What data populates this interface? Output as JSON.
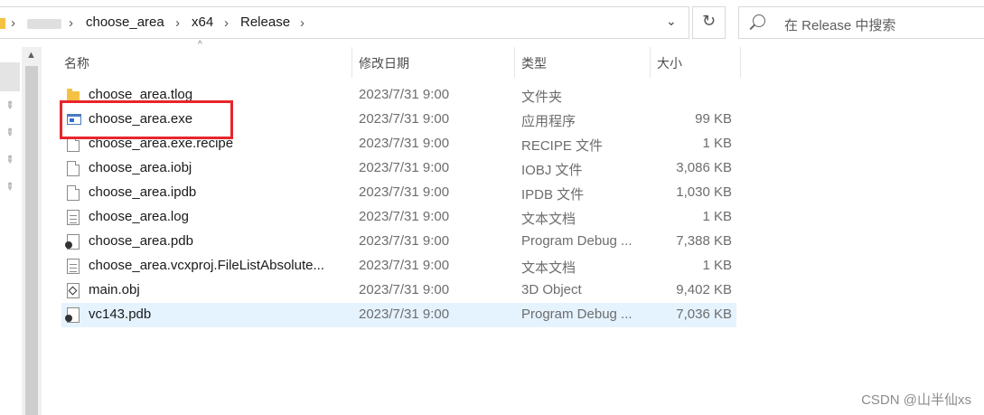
{
  "address": {
    "crumbs": [
      "choose_area",
      "x64",
      "Release"
    ],
    "separator": "›",
    "dropdown": "⌄",
    "refresh": "↻"
  },
  "search": {
    "placeholder": "在 Release 中搜索"
  },
  "columns": {
    "name": "名称",
    "modified": "修改日期",
    "type": "类型",
    "size": "大小"
  },
  "files": [
    {
      "name": "choose_area.tlog",
      "modified": "2023/7/31 9:00",
      "type": "文件夹",
      "size": "",
      "icon": "folder-icon"
    },
    {
      "name": "choose_area.exe",
      "modified": "2023/7/31 9:00",
      "type": "应用程序",
      "size": "99 KB",
      "icon": "exe-icon"
    },
    {
      "name": "choose_area.exe.recipe",
      "modified": "2023/7/31 9:00",
      "type": "RECIPE 文件",
      "size": "1 KB",
      "icon": "file-icon"
    },
    {
      "name": "choose_area.iobj",
      "modified": "2023/7/31 9:00",
      "type": "IOBJ 文件",
      "size": "3,086 KB",
      "icon": "file-icon"
    },
    {
      "name": "choose_area.ipdb",
      "modified": "2023/7/31 9:00",
      "type": "IPDB 文件",
      "size": "1,030 KB",
      "icon": "file-icon"
    },
    {
      "name": "choose_area.log",
      "modified": "2023/7/31 9:00",
      "type": "文本文档",
      "size": "1 KB",
      "icon": "text-file-icon"
    },
    {
      "name": "choose_area.pdb",
      "modified": "2023/7/31 9:00",
      "type": "Program Debug ...",
      "size": "7,388 KB",
      "icon": "pdb-icon"
    },
    {
      "name": "choose_area.vcxproj.FileListAbsolute...",
      "modified": "2023/7/31 9:00",
      "type": "文本文档",
      "size": "1 KB",
      "icon": "text-file-icon"
    },
    {
      "name": "main.obj",
      "modified": "2023/7/31 9:00",
      "type": "3D Object",
      "size": "9,402 KB",
      "icon": "3d-object-icon"
    },
    {
      "name": "vc143.pdb",
      "modified": "2023/7/31 9:00",
      "type": "Program Debug ...",
      "size": "7,036 KB",
      "icon": "pdb-icon"
    }
  ],
  "selected_index": 9,
  "highlight_color": "#e8262b",
  "selection_color": "#e5f3ff",
  "watermark": "CSDN @山半仙xs"
}
